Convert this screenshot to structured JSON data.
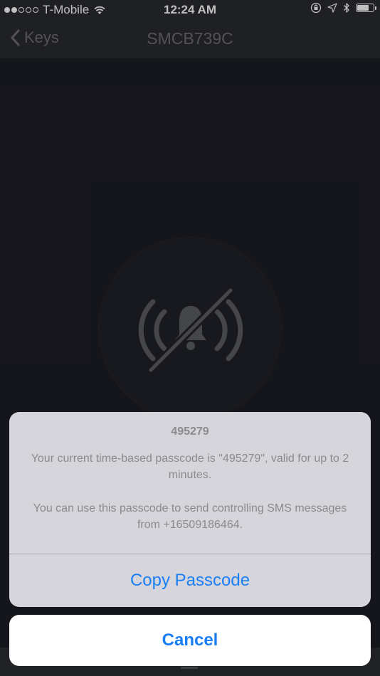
{
  "status_bar": {
    "carrier": "T-Mobile",
    "time": "12:24 AM",
    "signal_bars_filled": 2,
    "signal_bars_total": 5,
    "battery_level": 0.75,
    "icons": [
      "wifi-icon",
      "orientation-lock-icon",
      "location-arrow-icon",
      "bluetooth-icon",
      "battery-icon"
    ]
  },
  "nav": {
    "back_label": "Keys",
    "title": "SMCB739C"
  },
  "main": {
    "icon": "alarm-muted-icon"
  },
  "sheet": {
    "title": "495279",
    "message_1": "Your current time-based passcode is \"495279\", valid for up to 2 minutes.",
    "message_2": "You can use this passcode to send controlling SMS messages from +16509186464.",
    "copy_label": "Copy Passcode",
    "cancel_label": "Cancel"
  },
  "colors": {
    "action_blue": "#1a7ff6",
    "sheet_background": "#d5d5db",
    "screen_background": "#1d1e25"
  }
}
